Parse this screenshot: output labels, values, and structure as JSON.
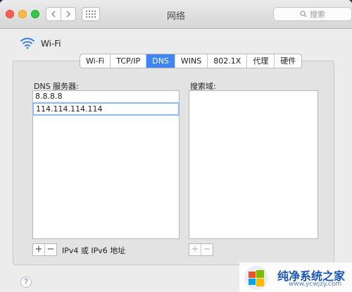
{
  "window": {
    "title": "网络"
  },
  "search": {
    "placeholder": "搜索"
  },
  "header": {
    "label": "Wi-Fi"
  },
  "tabs": [
    {
      "label": "Wi-Fi"
    },
    {
      "label": "TCP/IP"
    },
    {
      "label": "DNS"
    },
    {
      "label": "WINS"
    },
    {
      "label": "802.1X"
    },
    {
      "label": "代理"
    },
    {
      "label": "硬件"
    }
  ],
  "dns": {
    "label": "DNS 服务器:",
    "servers": [
      "8.8.8.8",
      "114.114.114.114"
    ],
    "footer": "IPv4 或 IPv6 地址"
  },
  "search_domains": {
    "label": "搜索域:"
  },
  "controls": {
    "plus": "+",
    "minus": "−"
  },
  "help": {
    "label": "?"
  },
  "watermark": {
    "text": "纯净系统之家",
    "url": "www.ycwjzy.com"
  }
}
